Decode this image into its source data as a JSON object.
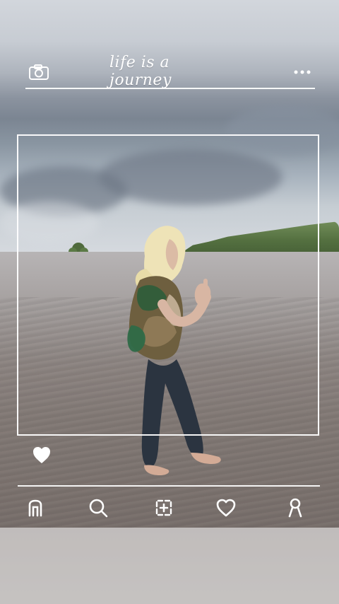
{
  "header": {
    "title": "life is a journey",
    "left_icon": "camera-icon",
    "right_icon": "more-icon"
  },
  "frame": {
    "like_icon": "heart-filled-icon"
  },
  "bottom_nav": [
    {
      "icon": "home-icon"
    },
    {
      "icon": "search-icon"
    },
    {
      "icon": "add-post-icon"
    },
    {
      "icon": "heart-icon"
    },
    {
      "icon": "profile-icon"
    }
  ],
  "colors": {
    "ui_white": "#ffffff"
  }
}
